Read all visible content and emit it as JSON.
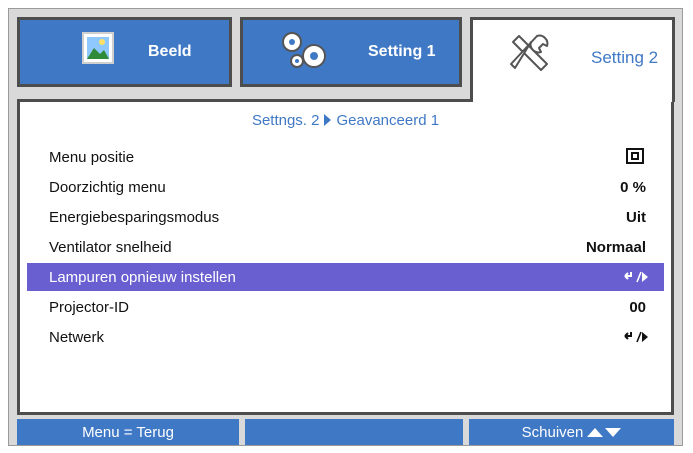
{
  "tabs": [
    {
      "label": "Beeld",
      "icon": "image-icon",
      "active": false
    },
    {
      "label": "Setting 1",
      "icon": "gears-icon",
      "active": false
    },
    {
      "label": "Setting 2",
      "icon": "tools-icon",
      "active": true
    }
  ],
  "breadcrumb": {
    "parent": "Settngs. 2",
    "current": "Geavanceerd 1"
  },
  "menu": [
    {
      "label": "Menu positie",
      "value": "",
      "value_icon": "menu-position-icon"
    },
    {
      "label": "Doorzichtig menu",
      "value": "0 %"
    },
    {
      "label": "Energiebesparingsmodus",
      "value": "Uit"
    },
    {
      "label": "Ventilator snelheid",
      "value": "Normaal"
    },
    {
      "label": "Lampuren opnieuw instellen",
      "value": "",
      "value_icon": "enter-arrow-icon",
      "selected": true
    },
    {
      "label": "Projector-ID",
      "value": "00"
    },
    {
      "label": "Netwerk",
      "value": "",
      "value_icon": "enter-arrow-icon"
    }
  ],
  "footer": {
    "back": "Menu = Terug",
    "middle": "",
    "scroll": "Schuiven"
  },
  "colors": {
    "accent": "#3f78c5",
    "selected": "#6a5fd0",
    "frame": "#4d4d4d",
    "background": "#d9d9d9"
  }
}
